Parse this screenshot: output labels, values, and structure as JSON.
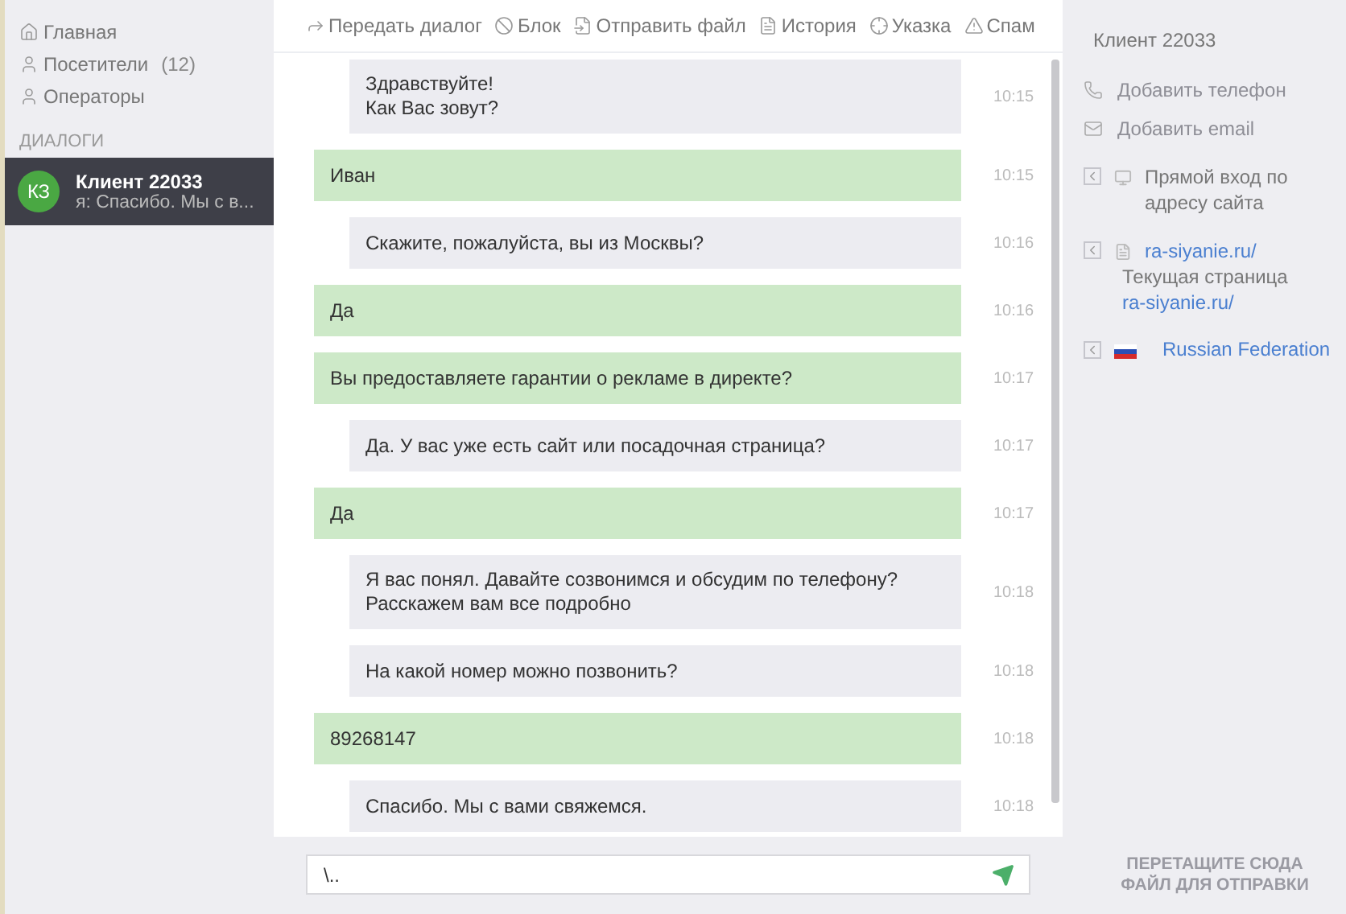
{
  "nav": [
    {
      "label": "Главная"
    },
    {
      "label": "Посетители",
      "count": "(12)"
    },
    {
      "label": "Операторы"
    }
  ],
  "dialogs_heading": "ДИАЛОГИ",
  "dialogs": [
    {
      "initials": "КЗ",
      "name": "Клиент 22033",
      "preview": "я: Спасибо. Мы с в...",
      "selected": true
    }
  ],
  "toolbar": [
    "Передать диалог",
    "Блок",
    "Отправить файл",
    "История",
    "Указка",
    "Спам"
  ],
  "messages": [
    {
      "kind": "operator",
      "lines": [
        "Здравствуйте!",
        "Как Вас зовут?"
      ],
      "time": "10:15"
    },
    {
      "kind": "client",
      "lines": [
        "Иван"
      ],
      "time": "10:15"
    },
    {
      "kind": "operator",
      "lines": [
        "Скажите, пожалуйста, вы из Москвы?"
      ],
      "time": "10:16"
    },
    {
      "kind": "client",
      "lines": [
        "Да"
      ],
      "time": "10:16"
    },
    {
      "kind": "client",
      "lines": [
        "Вы предоставляете гарантии о рекламе в директе?"
      ],
      "time": "10:17"
    },
    {
      "kind": "operator",
      "lines": [
        "Да. У вас уже есть сайт или посадочная страница?"
      ],
      "time": "10:17"
    },
    {
      "kind": "client",
      "lines": [
        "Да"
      ],
      "time": "10:17"
    },
    {
      "kind": "operator",
      "lines": [
        "Я вас понял. Давайте созвонимся и обсудим по телефону?",
        "Расскажем вам все подробно"
      ],
      "time": "10:18"
    },
    {
      "kind": "operator",
      "lines": [
        "На какой номер можно позвонить?"
      ],
      "time": "10:18"
    },
    {
      "kind": "client",
      "lines": [
        "89268147"
      ],
      "time": "10:18"
    },
    {
      "kind": "operator",
      "lines": [
        "Спасибо. Мы с вами свяжемся."
      ],
      "time": "10:18"
    }
  ],
  "input": {
    "value": "\\.."
  },
  "drop_hint": [
    "ПЕРЕТАЩИТЕ СЮДА",
    "ФАЙЛ ДЛЯ ОТПРАВКИ"
  ],
  "client": {
    "name": "Клиент 22033",
    "contacts": [
      "Добавить телефон",
      "Добавить email"
    ],
    "sources": [
      {
        "kind": "entry",
        "text": "Прямой вход по адресу сайта"
      },
      {
        "kind": "page",
        "link": "ra-siyanie.ru/",
        "caption": "Текущая страница",
        "caption_link": "ra-siyanie.ru/"
      },
      {
        "kind": "country",
        "text": "Russian Federation"
      }
    ]
  }
}
